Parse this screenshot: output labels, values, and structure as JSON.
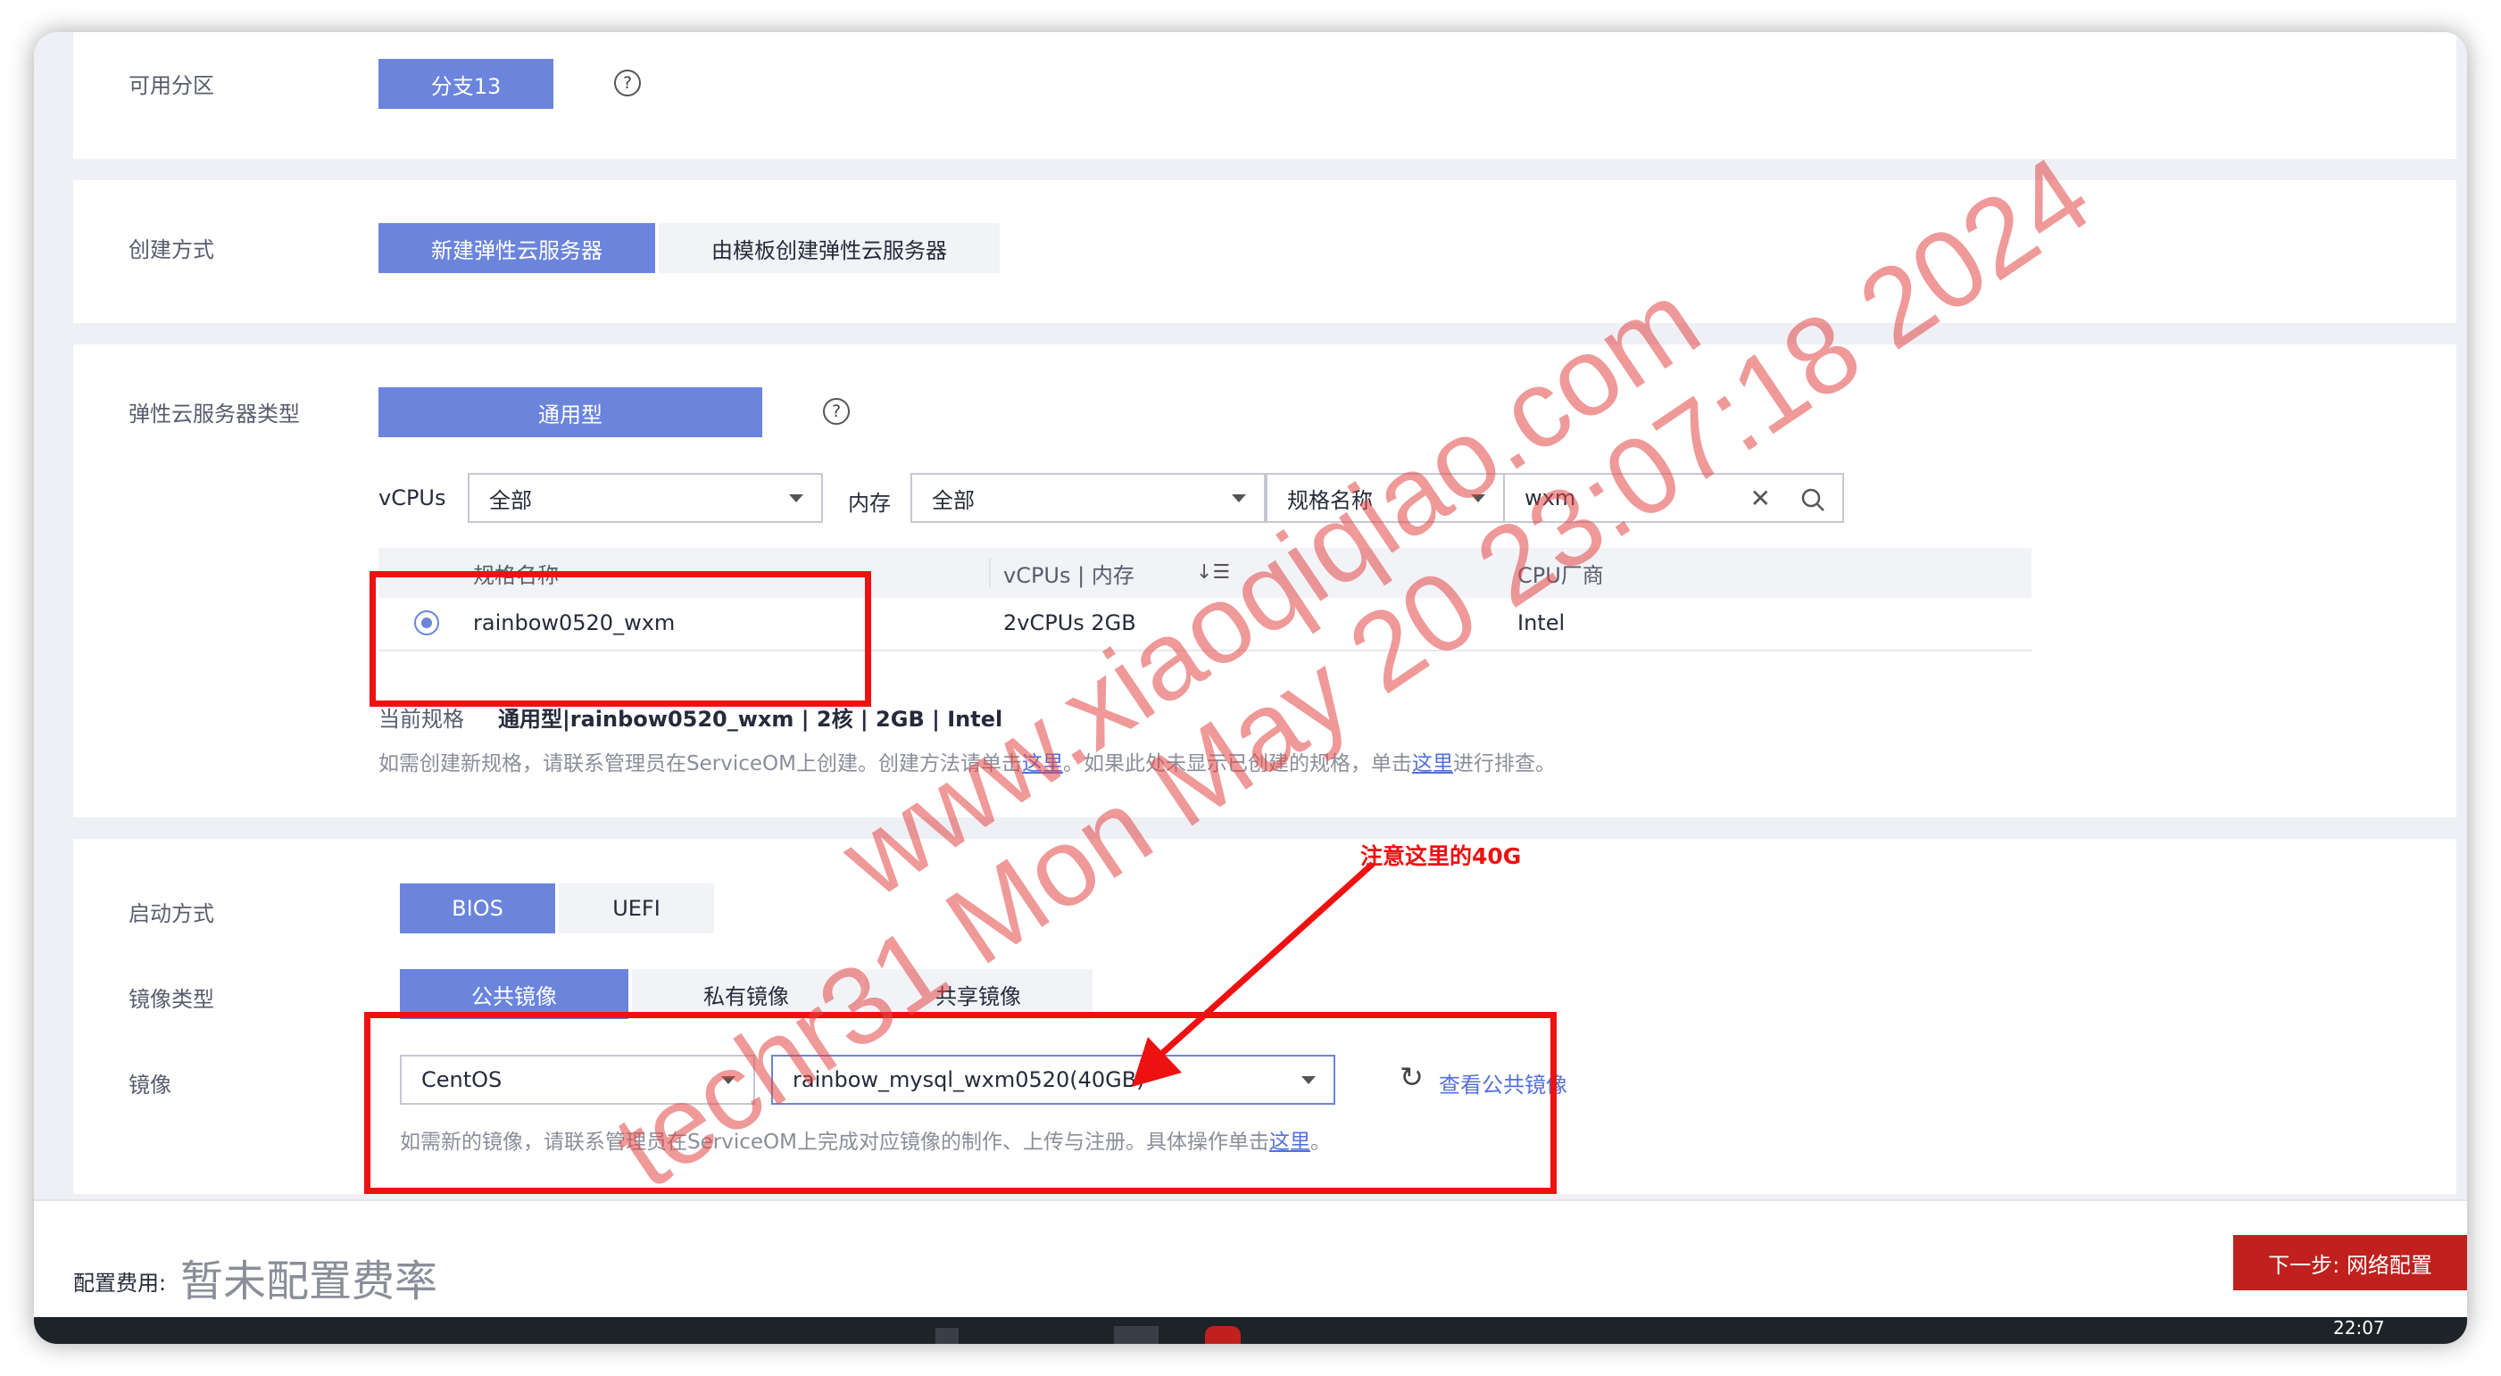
{
  "az": {
    "label": "可用分区",
    "value": "分支13"
  },
  "create_mode": {
    "label": "创建方式",
    "options": [
      "新建弹性云服务器",
      "由模板创建弹性云服务器"
    ]
  },
  "ecs_type": {
    "label": "弹性云服务器类型",
    "option": "通用型",
    "filters": {
      "vcpus_label": "vCPUs",
      "vcpus_value": "全部",
      "mem_label": "内存",
      "mem_value": "全部",
      "name_select": "规格名称",
      "search_value": "wxm"
    },
    "table": {
      "headers": [
        "规格名称",
        "vCPUs | 内存",
        "CPU厂商"
      ],
      "rows": [
        {
          "name": "rainbow0520_wxm",
          "spec": "2vCPUs 2GB",
          "vendor": "Intel"
        }
      ]
    },
    "current_label": "当前规格",
    "current_value": "通用型|rainbow0520_wxm | 2核 | 2GB | Intel",
    "hint_a": "如需创建新规格，请联系管理员在ServiceOM上创建。创建方法请单击",
    "hint_link1": "这里",
    "hint_b": "。如果此处未显示已创建的规格，单击",
    "hint_link2": "这里",
    "hint_c": "进行排查。"
  },
  "boot": {
    "label": "启动方式",
    "options": [
      "BIOS",
      "UEFI"
    ]
  },
  "image_type": {
    "label": "镜像类型",
    "options": [
      "公共镜像",
      "私有镜像",
      "共享镜像"
    ]
  },
  "image": {
    "label": "镜像",
    "os_value": "CentOS",
    "image_value": "rainbow_mysql_wxm0520(40GB)",
    "view_link": "查看公共镜像",
    "hint_a": "如需新的镜像，请联系管理员在ServiceOM上完成对应镜像的制作、上传与注册。具体操作单击",
    "hint_link": "这里",
    "hint_b": "。"
  },
  "annotation": "注意这里的40G",
  "footer": {
    "fee_label": "配置费用:",
    "fee_value": "暂未配置费率",
    "next_button": "下一步: 网络配置"
  },
  "taskbar": {
    "time": "22:07"
  },
  "watermark": {
    "line1": "www.xiaoqiqiao.com",
    "line2": "techr31 Mon May 20 23:07:18 2024"
  },
  "colors": {
    "primary": "#6b84dc",
    "annotation_red": "#ee1111",
    "next_button": "#c0211f",
    "link": "#5470d9"
  }
}
